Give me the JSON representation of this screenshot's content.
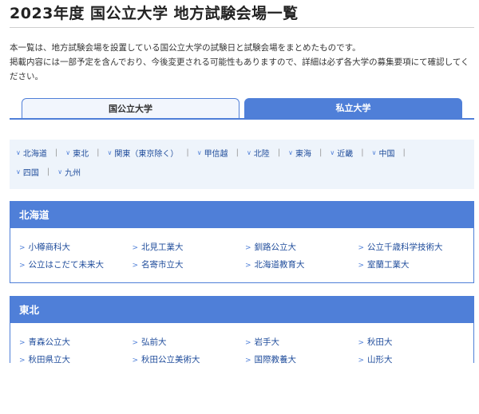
{
  "page": {
    "title": "2023年度 国公立大学 地方試験会場一覧",
    "intro_line1": "本一覧は、地方試験会場を設置している国公立大学の試験日と試験会場をまとめたものです。",
    "intro_line2": "掲載内容には一部予定を含んでおり、今後変更される可能性もありますので、詳細は必ず各大学の募集要項にて確認してく",
    "intro_line3": "ださい。"
  },
  "tabs": {
    "national": "国公立大学",
    "private": "私立大学"
  },
  "regions": {
    "chevron": "∨",
    "separator": "|",
    "row1": [
      "北海道",
      "東北",
      "関東（東京除く）",
      "甲信越",
      "北陸",
      "東海",
      "近畿",
      "中国"
    ],
    "row2": [
      "四国",
      "九州"
    ]
  },
  "sections": {
    "hokkaido": {
      "title": "北海道",
      "rows": [
        [
          "小樽商科大",
          "北見工業大",
          "釧路公立大",
          "公立千歳科学技術大"
        ],
        [
          "公立はこだて未来大",
          "名寄市立大",
          "北海道教育大",
          "室蘭工業大"
        ]
      ]
    },
    "tohoku": {
      "title": "東北",
      "rows": [
        [
          "青森公立大",
          "弘前大",
          "岩手大",
          "秋田大"
        ],
        [
          "秋田県立大",
          "秋田公立美術大",
          "国際教養大",
          "山形大"
        ]
      ]
    }
  },
  "icons": {
    "link_chevron": ">"
  },
  "colors": {
    "accent": "#4f7fd8",
    "link": "#1f4c9b",
    "region_bg": "#eef4fb"
  }
}
